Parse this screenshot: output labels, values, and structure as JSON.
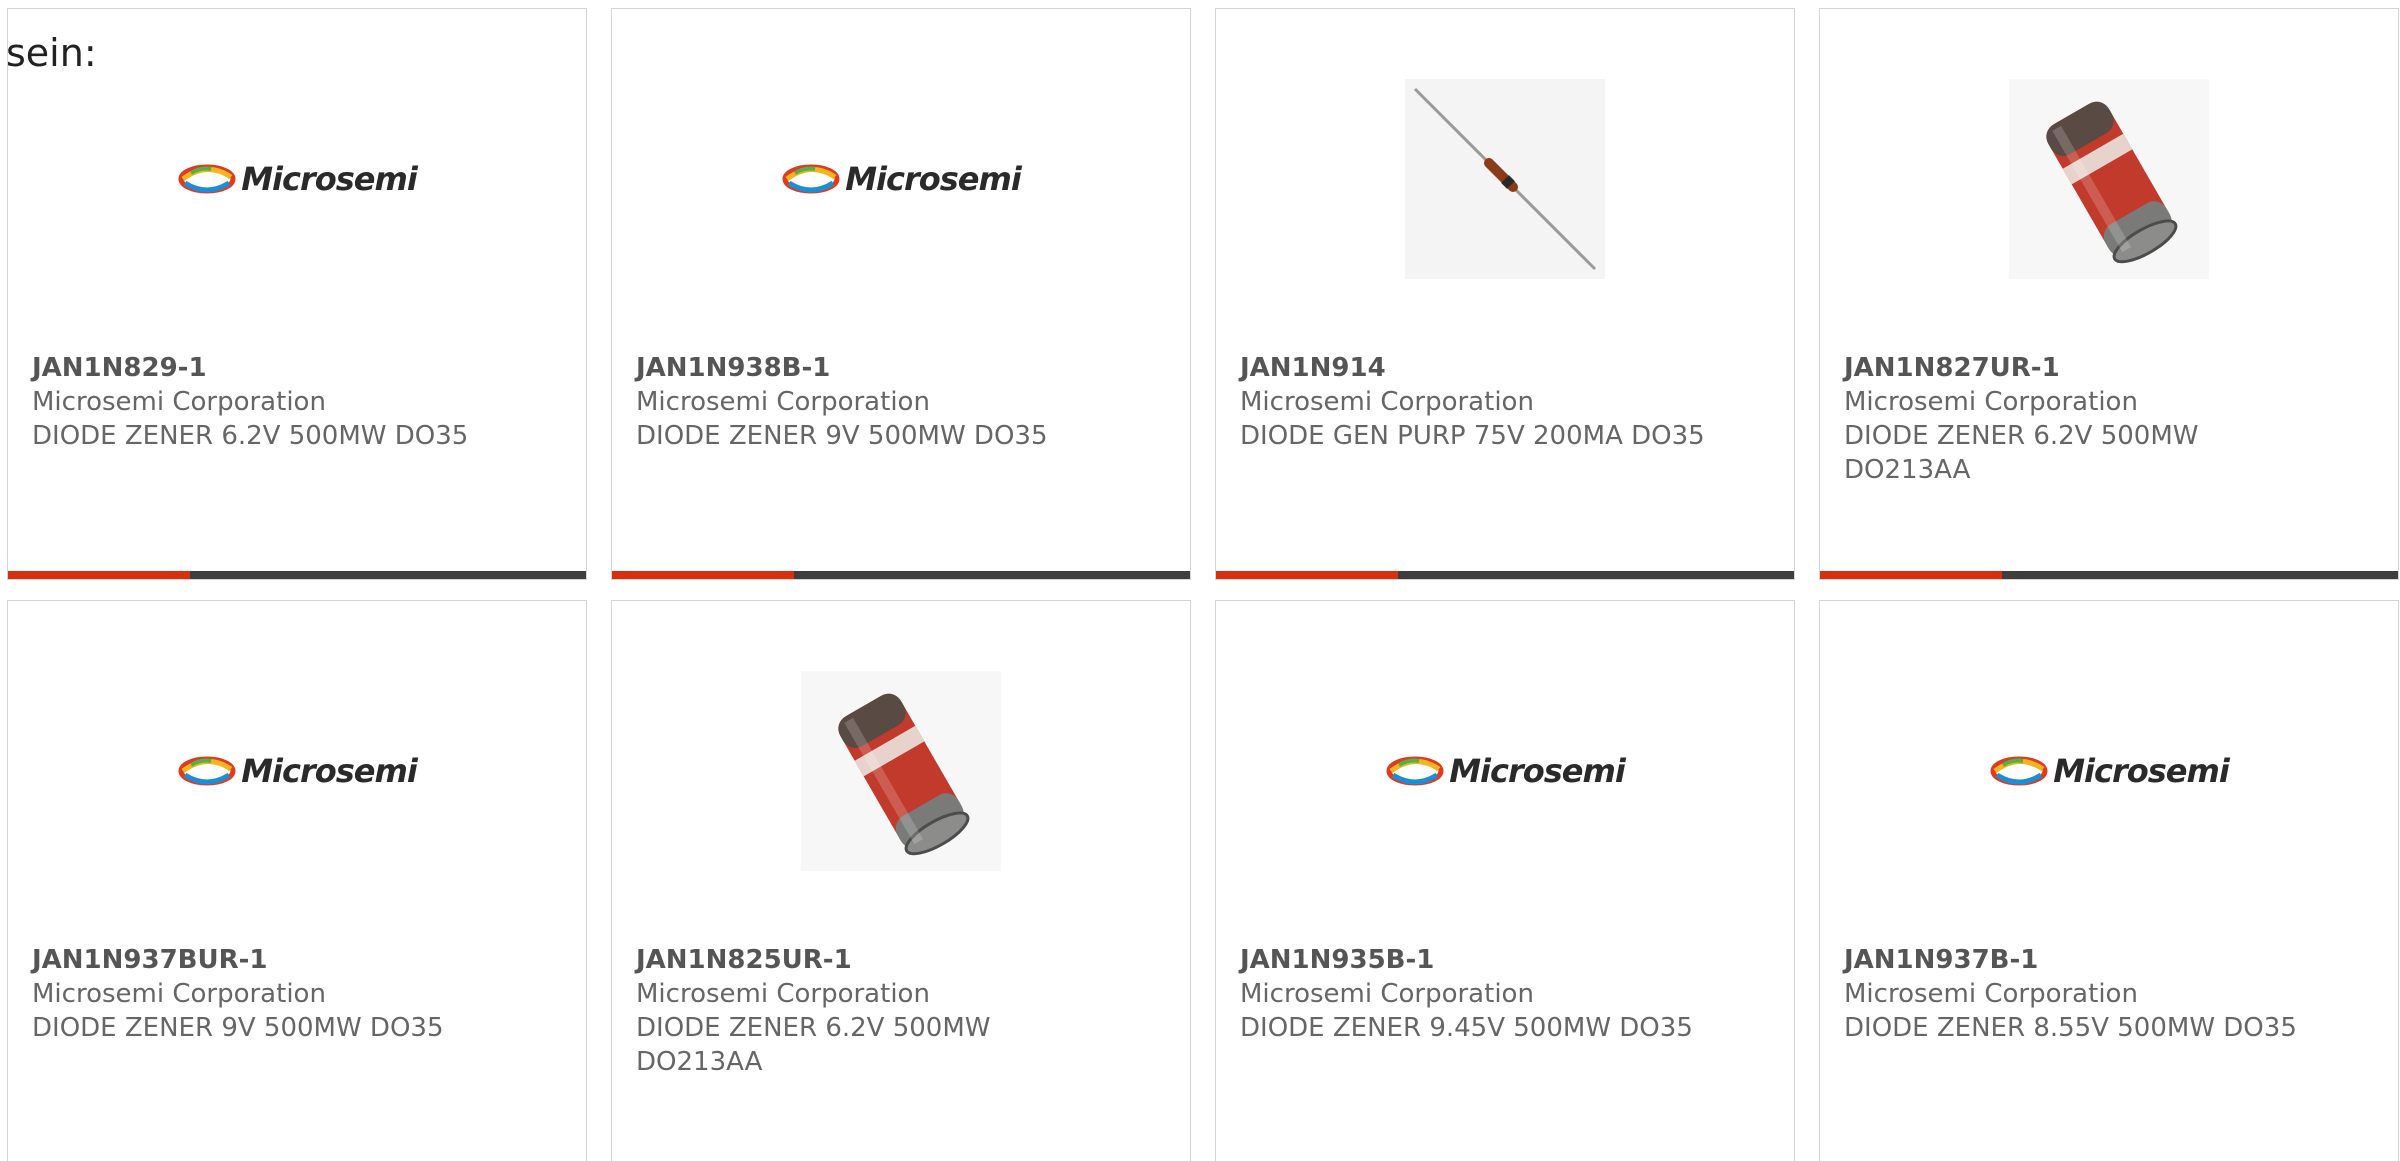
{
  "heading": "sein:",
  "brand": {
    "logo_text": "Microsemi",
    "accent_color": "#d8300e",
    "bar_color": "#3d3d3d"
  },
  "products": [
    {
      "part": "JAN1N829-1",
      "manufacturer": "Microsemi Corporation",
      "description": "DIODE ZENER 6.2V 500MW DO35",
      "image": "microsemi-logo"
    },
    {
      "part": "JAN1N938B-1",
      "manufacturer": "Microsemi Corporation",
      "description": "DIODE ZENER 9V 500MW DO35",
      "image": "microsemi-logo"
    },
    {
      "part": "JAN1N914",
      "manufacturer": "Microsemi Corporation",
      "description": "DIODE GEN PURP 75V 200MA DO35",
      "image": "axial-diode-photo"
    },
    {
      "part": "JAN1N827UR-1",
      "manufacturer": "Microsemi Corporation",
      "description": "DIODE ZENER 6.2V 500MW DO213AA",
      "image": "melf-diode-photo"
    },
    {
      "part": "JAN1N937BUR-1",
      "manufacturer": "Microsemi Corporation",
      "description": "DIODE ZENER 9V 500MW DO35",
      "image": "microsemi-logo"
    },
    {
      "part": "JAN1N825UR-1",
      "manufacturer": "Microsemi Corporation",
      "description": "DIODE ZENER 6.2V 500MW DO213AA",
      "image": "melf-diode-photo"
    },
    {
      "part": "JAN1N935B-1",
      "manufacturer": "Microsemi Corporation",
      "description": "DIODE ZENER 9.45V 500MW DO35",
      "image": "microsemi-logo"
    },
    {
      "part": "JAN1N937B-1",
      "manufacturer": "Microsemi Corporation",
      "description": "DIODE ZENER 8.55V 500MW DO35",
      "image": "microsemi-logo"
    }
  ]
}
